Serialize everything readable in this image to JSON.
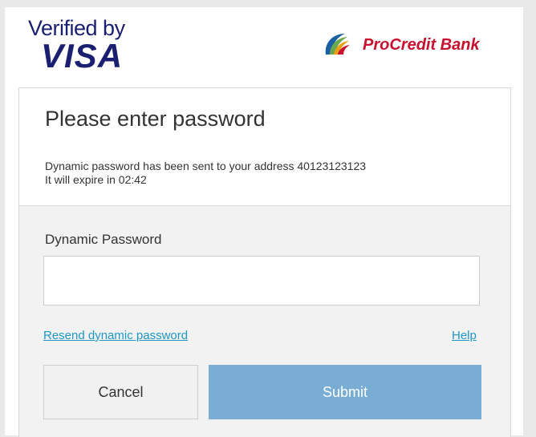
{
  "header": {
    "verified_by": "Verified by",
    "visa": "VISA",
    "bank_name": "ProCredit Bank",
    "bank_logo_icon": "procredit-swirl-logo"
  },
  "card": {
    "title": "Please enter password",
    "message_line1": "Dynamic password has been sent to your address 40123123123",
    "message_line2": "It will expire in 02:42",
    "field_label": "Dynamic Password",
    "password_value": "",
    "password_placeholder": "",
    "resend_label": "Resend dynamic password",
    "help_label": "Help",
    "cancel_label": "Cancel",
    "submit_label": "Submit"
  },
  "colors": {
    "visa_blue": "#1a1f71",
    "bank_red": "#c8102e",
    "link_blue": "#1f97c4",
    "submit_blue": "#79add4"
  }
}
